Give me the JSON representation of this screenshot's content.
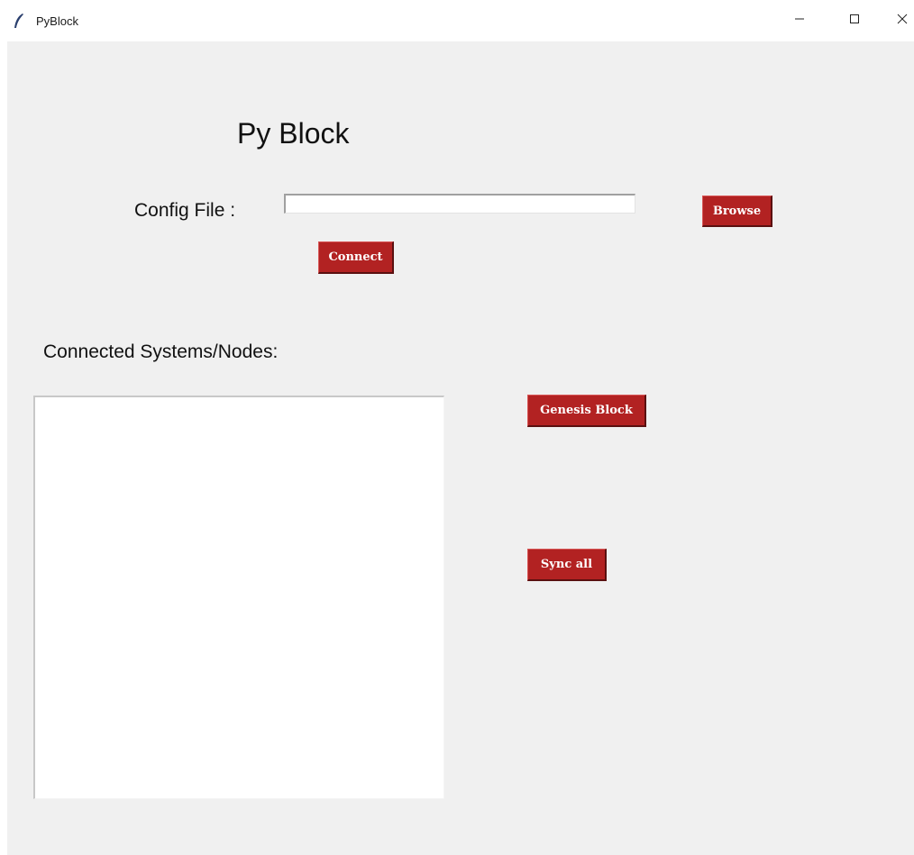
{
  "window": {
    "title": "PyBlock",
    "minimize_glyph": "–",
    "maximize_glyph": "☐",
    "close_glyph": "✕",
    "icon": "feather-icon"
  },
  "main": {
    "heading": "Py Block",
    "config_label": "Config File :",
    "config_value": "",
    "browse_label": "Browse",
    "connect_label": "Connect",
    "nodes_label": "Connected Systems/Nodes:",
    "nodes_list": [],
    "genesis_label": "Genesis Block",
    "sync_label": "Sync all"
  },
  "colors": {
    "button_bg": "#b22222",
    "button_text": "#ffffff",
    "window_bg": "#f0f0f0"
  }
}
